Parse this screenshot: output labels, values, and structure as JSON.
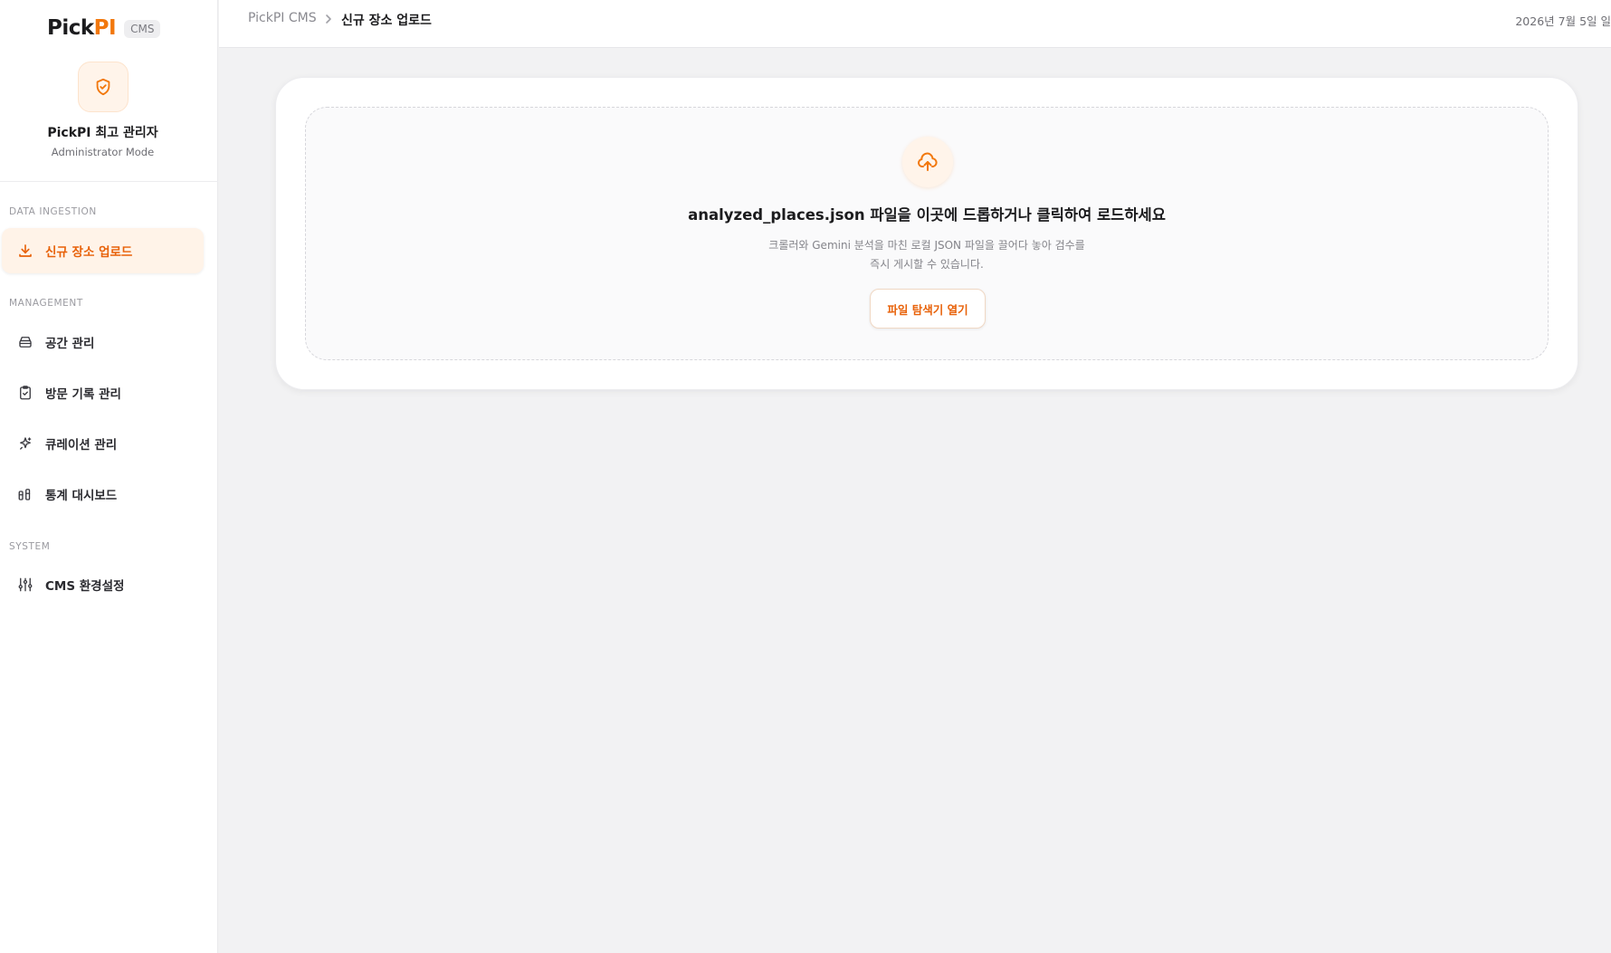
{
  "brand": {
    "name_part1": "Pick",
    "name_part2": "PI",
    "badge": "CMS",
    "accent_color": "#f2780d"
  },
  "admin": {
    "icon": "shield-check-icon",
    "name": "PickPI 최고 관리자",
    "mode": "Administrator Mode"
  },
  "sidebar": {
    "sections": [
      {
        "label": "DATA INGESTION"
      },
      {
        "label": "MANAGEMENT"
      },
      {
        "label": "SYSTEM"
      }
    ],
    "items": [
      {
        "label": "신규 장소 업로드",
        "icon": "download-icon",
        "active": true
      },
      {
        "label": "공간 관리",
        "icon": "layers-icon"
      },
      {
        "label": "방문 기록 관리",
        "icon": "clipboard-check-icon"
      },
      {
        "label": "큐레이션 관리",
        "icon": "sparkles-icon"
      },
      {
        "label": "통계 대시보드",
        "icon": "chart-bars-icon"
      },
      {
        "label": "CMS 환경설정",
        "icon": "sliders-icon"
      }
    ]
  },
  "header": {
    "breadcrumb_root": "PickPI CMS",
    "breadcrumb_current": "신규 장소 업로드",
    "date": "2026년 7월 5일 일"
  },
  "upload": {
    "icon": "cloud-upload-icon",
    "title": "analyzed_places.json 파일을 이곳에 드롭하거나 클릭하여 로드하세요",
    "description_line1": "크롤러와 Gemini 분석을 마친 로컬 JSON 파일을 끌어다 놓아 검수를",
    "description_line2": "즉시 게시할 수 있습니다.",
    "button_label": "파일 탐색기 열기"
  }
}
